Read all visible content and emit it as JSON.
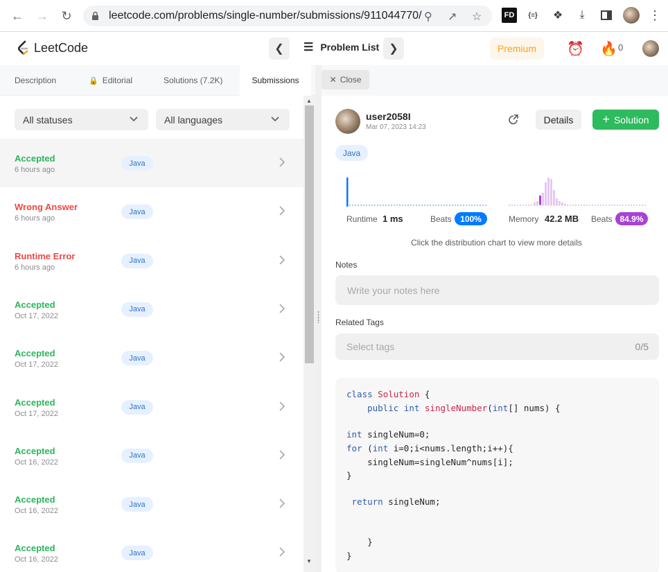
{
  "browser": {
    "url": "leetcode.com/problems/single-number/submissions/911044770/"
  },
  "header": {
    "logo_text": "LeetCode",
    "problem_list_label": "Problem List",
    "premium_label": "Premium",
    "streak_count": "0"
  },
  "tabs": [
    {
      "label": "Description"
    },
    {
      "label": "Editorial"
    },
    {
      "label": "Solutions (7.2K)"
    },
    {
      "label": "Submissions"
    }
  ],
  "close_tab_label": "Close",
  "filters": {
    "status": "All statuses",
    "language": "All languages"
  },
  "submissions": [
    {
      "status": "Accepted",
      "time": "6 hours ago",
      "lang": "Java"
    },
    {
      "status": "Wrong Answer",
      "time": "6 hours ago",
      "lang": "Java"
    },
    {
      "status": "Runtime Error",
      "time": "6 hours ago",
      "lang": "Java"
    },
    {
      "status": "Accepted",
      "time": "Oct 17, 2022",
      "lang": "Java"
    },
    {
      "status": "Accepted",
      "time": "Oct 17, 2022",
      "lang": "Java"
    },
    {
      "status": "Accepted",
      "time": "Oct 17, 2022",
      "lang": "Java"
    },
    {
      "status": "Accepted",
      "time": "Oct 16, 2022",
      "lang": "Java"
    },
    {
      "status": "Accepted",
      "time": "Oct 16, 2022",
      "lang": "Java"
    },
    {
      "status": "Accepted",
      "time": "Oct 16, 2022",
      "lang": "Java"
    }
  ],
  "detail": {
    "username": "user2058I",
    "date": "Mar 07, 2023 14:23",
    "details_label": "Details",
    "solution_label": "Solution",
    "language": "Java",
    "runtime_label": "Runtime",
    "runtime_value": "1 ms",
    "runtime_beats_label": "Beats",
    "runtime_beats": "100%",
    "memory_label": "Memory",
    "memory_value": "42.2 MB",
    "memory_beats_label": "Beats",
    "memory_beats": "84.9%",
    "hint": "Click the distribution chart to view more details",
    "notes_label": "Notes",
    "notes_placeholder": "Write your notes here",
    "tags_label": "Related Tags",
    "tags_placeholder": "Select tags",
    "tags_count": "0/5"
  },
  "colors": {
    "accepted": "#2db55d",
    "error": "#ef4743",
    "runtime_accent": "#007aff",
    "memory_accent": "#a742d6",
    "brand_green": "#2cbb5d",
    "premium": "#ffa116"
  },
  "code": [
    "class Solution {",
    "    public int singleNumber(int[] nums) {",
    "",
    "int singleNum=0;",
    "for (int i=0;i<nums.length;i++){",
    "    singleNum=singleNum^nums[i];",
    "}",
    "",
    " return singleNum;",
    "",
    "",
    "    }",
    "}"
  ]
}
